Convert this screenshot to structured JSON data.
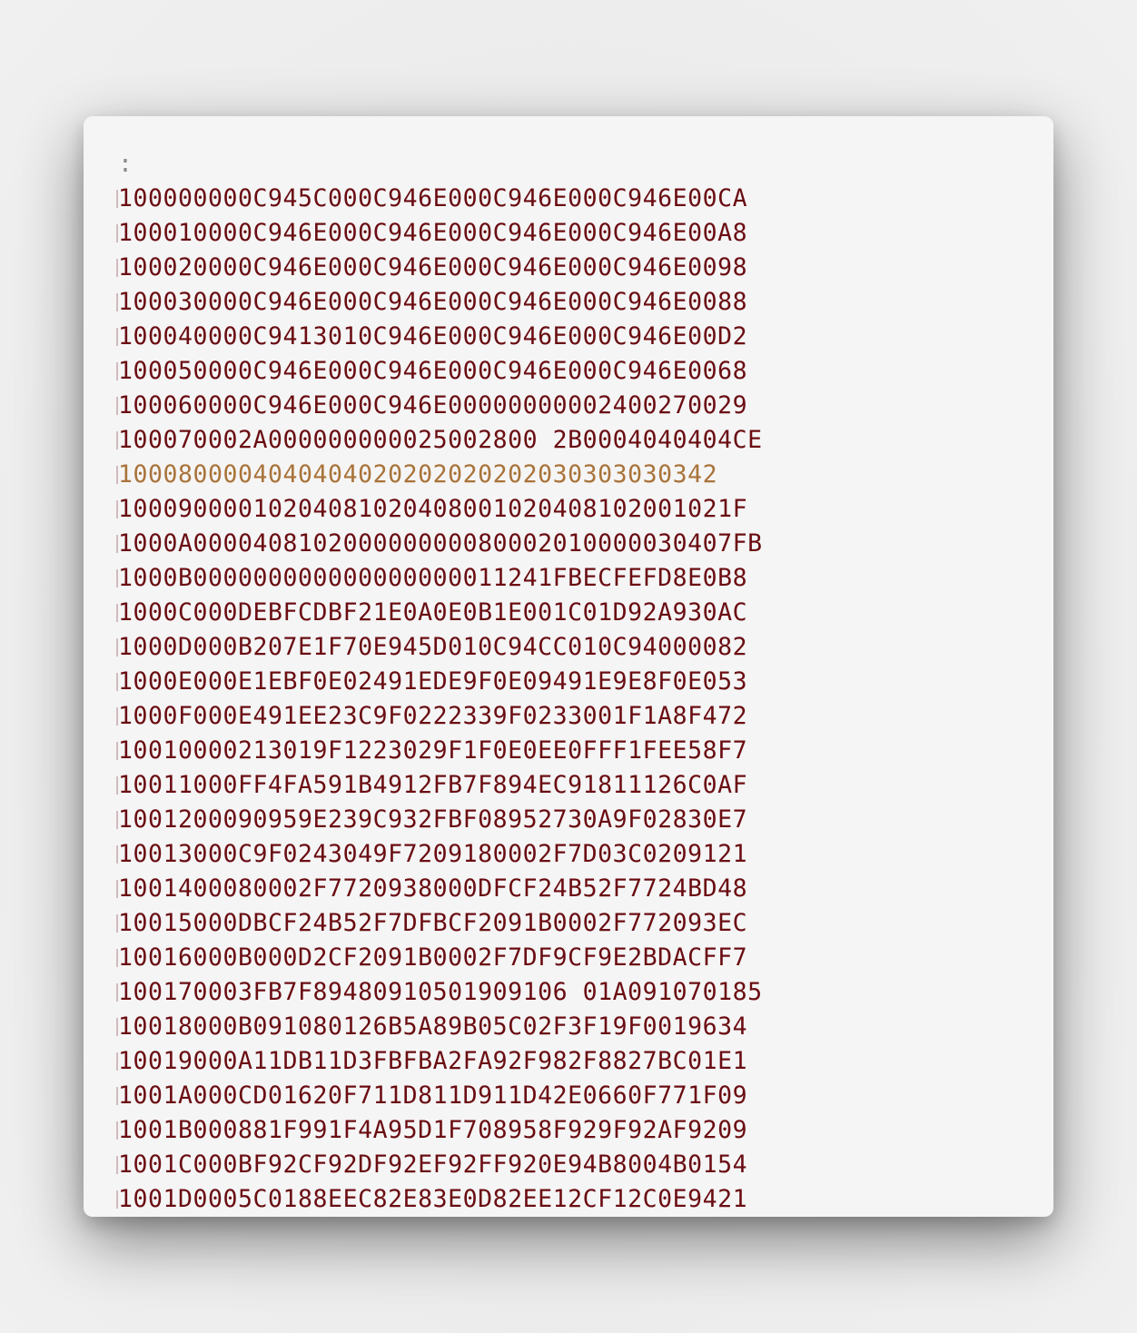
{
  "colors": {
    "record": "#6a0d12",
    "record_highlighted": "#a9733a",
    "colon": "#8a8a8a",
    "panel": "#f5f5f5"
  },
  "editor": {
    "start_code": ":",
    "highlighted_index": 8,
    "lines": [
      "100000000C945C000C946E000C946E000C946E00CA",
      "100010000C946E000C946E000C946E000C946E00A8",
      "100020000C946E000C946E000C946E000C946E0098",
      "100030000C946E000C946E000C946E000C946E0088",
      "100040000C9413010C946E000C946E000C946E00D2",
      "100050000C946E000C946E000C946E000C946E0068",
      "100060000C946E000C946E00000000002400270029",
      "100070002A000000000025002800 2B0004040404CE",
      "1000800004040404020202020202030303030342",
      "10009000010204081020408001020408102001021F",
      "1000A000040810200000000080002010000030407FB",
      "1000B000000000000000000011241FBECFEFD8E0B8",
      "1000C000DEBFCDBF21E0A0E0B1E001C01D92A930AC",
      "1000D000B207E1F70E945D010C94CC010C94000082",
      "1000E000E1EBF0E02491EDE9F0E09491E9E8F0E053",
      "1000F000E491EE23C9F0222339F0233001F1A8F472",
      "10010000213019F1223029F1F0E0EE0FFF1FEE58F7",
      "10011000FF4FA591B4912FB7F894EC91811126C0AF",
      "1001200090959E239C932FBF08952730A9F02830E7",
      "10013000C9F0243049F7209180002F7D03C0209121",
      "1001400080002F7720938000DFCF24B52F7724BD48",
      "10015000DBCF24B52F7DFBCF2091B0002F772093EC",
      "10016000B000D2CF2091B0002F7DF9CF9E2BDACFF7",
      "100170003FB7F89480910501909106 01A091070185",
      "10018000B091080126B5A89B05C02F3F19F0019634",
      "10019000A11DB11D3FBFBA2FA92F982F8827BC01E1",
      "1001A000CD01620F711D811D911D42E0660F771F09",
      "1001B000881F991F4A95D1F708958F929F92AF9209",
      "1001C000BF92CF92DF92EF92FF920E94B8004B0154",
      "1001D0005C0188EEC82E83E0D82EE12CF12C0E9421"
    ]
  }
}
